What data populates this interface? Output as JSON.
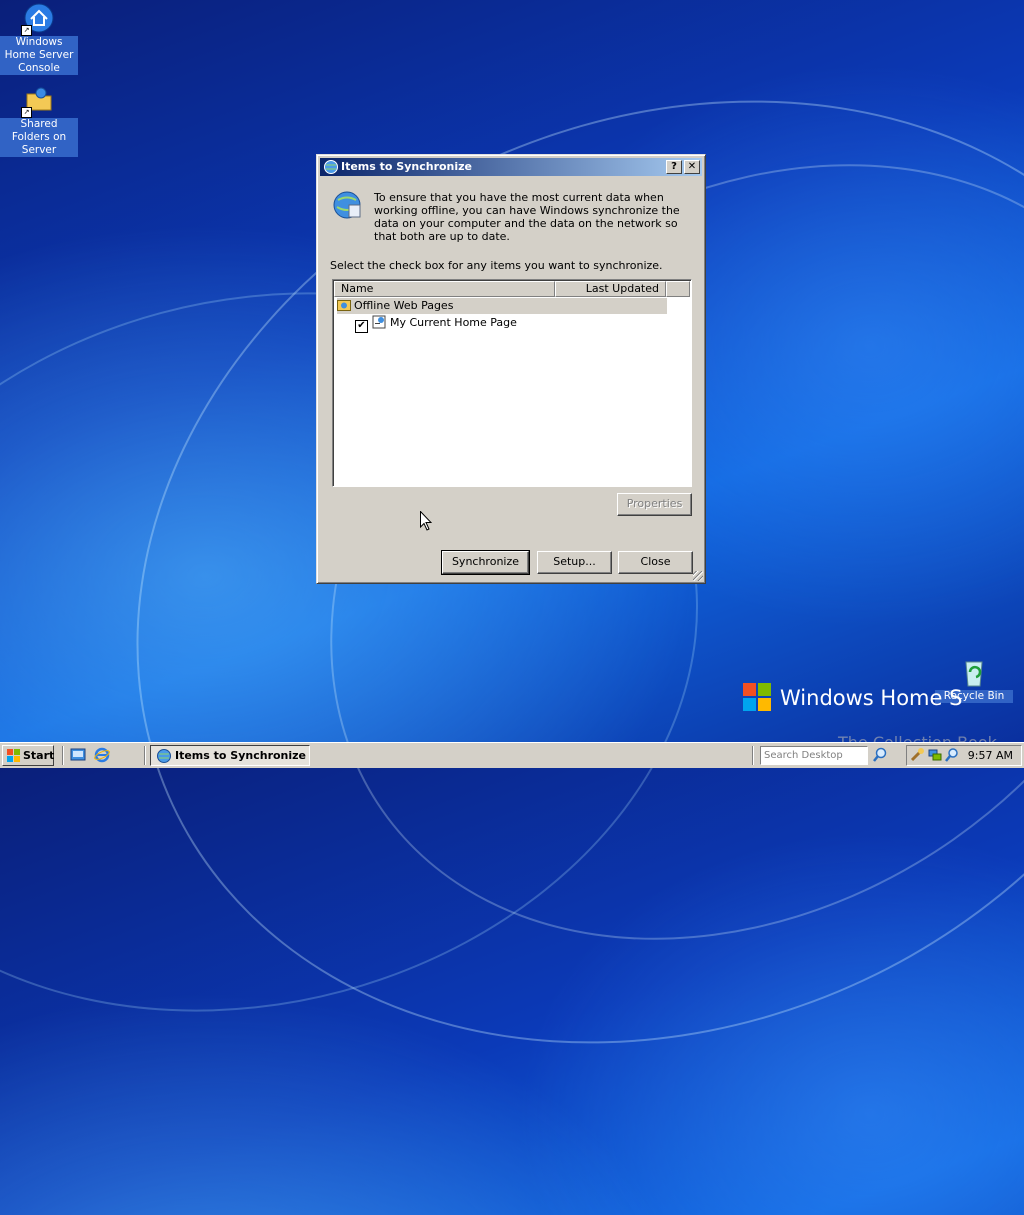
{
  "desktop": {
    "icons": [
      {
        "label": "Windows Home Server Console",
        "icon": "home-server-icon"
      },
      {
        "label": "Shared Folders on Server",
        "icon": "shared-folders-icon"
      },
      {
        "label": "Recycle Bin",
        "icon": "recycle-bin-icon"
      }
    ],
    "branding": "Windows Home S",
    "watermark": "The Collection Book"
  },
  "dialog": {
    "title": "Items to Synchronize",
    "help_label": "?",
    "close_label": "✕",
    "description": "To ensure that you have the most current data when working offline, you can have Windows synchronize the data on your computer and the data on the network so that both are up to date.",
    "instruction": "Select the check box for any items you want to synchronize.",
    "columns": [
      "Name",
      "Last Updated"
    ],
    "items": [
      {
        "label": "Offline Web Pages",
        "level": 0
      },
      {
        "label": "My Current Home Page",
        "level": 1,
        "checked": true
      }
    ],
    "buttons": {
      "properties": "Properties",
      "synchronize": "Synchronize",
      "setup": "Setup...",
      "close": "Close"
    }
  },
  "taskbar": {
    "start_label": "Start",
    "task_label": "Items to Synchronize",
    "search_placeholder": "Search Desktop",
    "clock": "9:57 AM"
  },
  "colors": {
    "titlebar_start": "#0a246a",
    "titlebar_end": "#a6caf0",
    "face": "#d4d0c8",
    "selection_label": "#3163c5"
  }
}
